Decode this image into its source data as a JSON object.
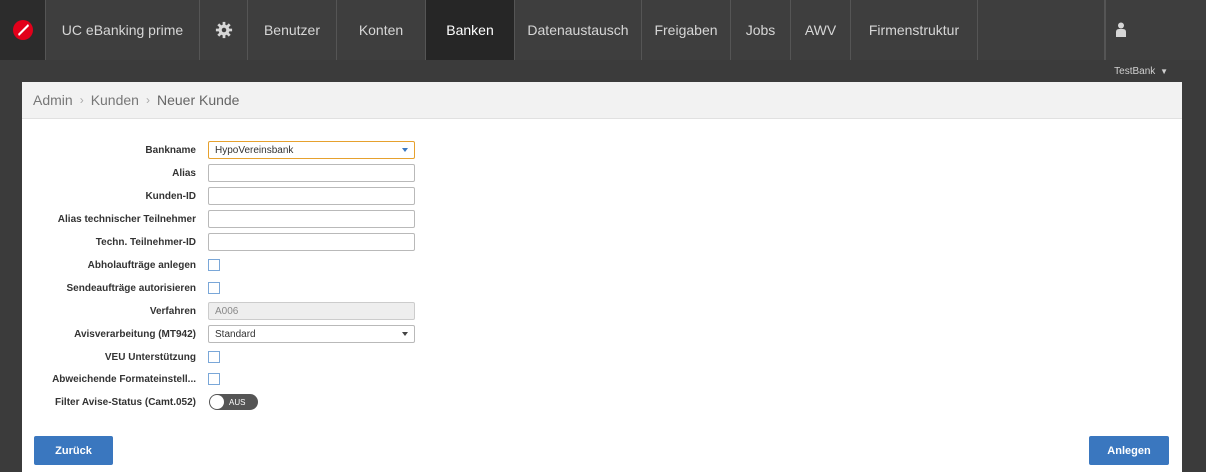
{
  "nav": {
    "brand": "UC eBanking prime",
    "items": [
      "Benutzer",
      "Konten",
      "Banken",
      "Datenaustausch",
      "Freigaben",
      "Jobs",
      "AWV",
      "Firmenstruktur"
    ],
    "active": "Banken"
  },
  "context": {
    "bank": "TestBank"
  },
  "breadcrumb": {
    "admin": "Admin",
    "kunden": "Kunden",
    "current": "Neuer Kunde",
    "separator": "›"
  },
  "form": {
    "bankname": {
      "label": "Bankname",
      "value": "HypoVereinsbank"
    },
    "alias": {
      "label": "Alias",
      "value": ""
    },
    "kunden_id": {
      "label": "Kunden-ID",
      "value": ""
    },
    "alias_tech": {
      "label": "Alias technischer Teilnehmer",
      "value": ""
    },
    "tech_id": {
      "label": "Techn. Teilnehmer-ID",
      "value": ""
    },
    "abholauftraege": {
      "label": "Abholaufträge anlegen",
      "checked": false
    },
    "sendeauftraege": {
      "label": "Sendeaufträge autorisieren",
      "checked": false
    },
    "verfahren": {
      "label": "Verfahren",
      "value": "A006"
    },
    "avis": {
      "label": "Avisverarbeitung (MT942)",
      "value": "Standard"
    },
    "veu": {
      "label": "VEU Unterstützung",
      "checked": false
    },
    "formate": {
      "label": "Abweichende Formateinstell...",
      "checked": false
    },
    "filter": {
      "label": "Filter Avise-Status (Camt.052)",
      "toggle_text": "AUS"
    }
  },
  "buttons": {
    "back": "Zurück",
    "create": "Anlegen"
  },
  "colors": {
    "nav_bg": "#3e3e3e",
    "nav_active": "#262626",
    "primary_button": "#3a77bf",
    "logo_red": "#e2001a"
  }
}
